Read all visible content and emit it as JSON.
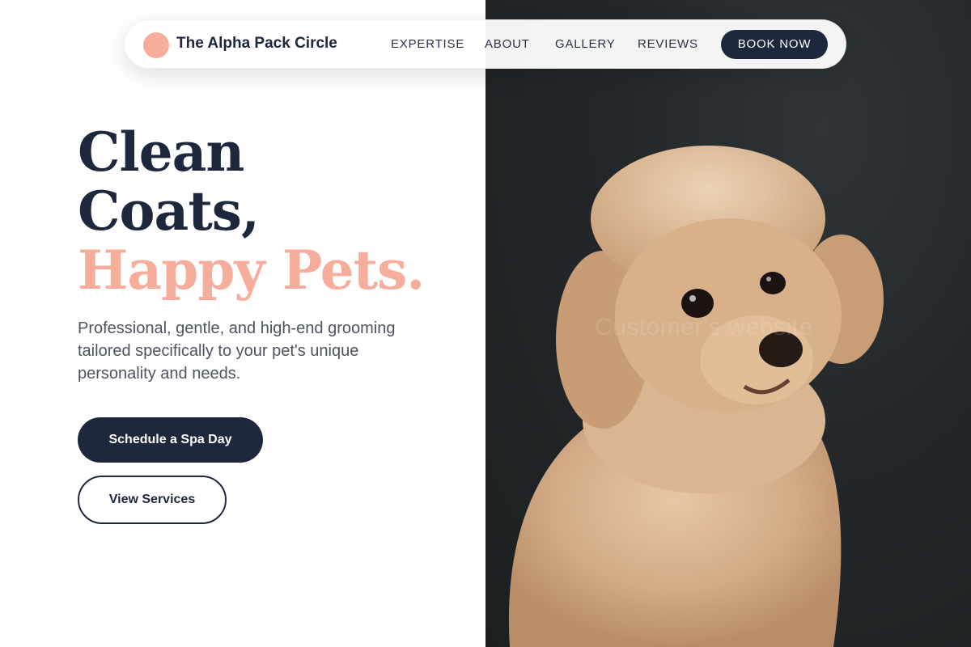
{
  "brand": {
    "name": "The Alpha Pack Circle",
    "accent_color": "#f6ad9b",
    "dark_color": "#1d283c"
  },
  "nav": {
    "links": [
      "EXPERTISE",
      "ABOUT",
      "GALLERY",
      "REVIEWS"
    ],
    "cta": "BOOK NOW"
  },
  "hero": {
    "headline_line1": "Clean",
    "headline_line2": "Coats,",
    "headline_accent": "Happy Pets.",
    "subtitle": "Professional, gentle, and high-end grooming tailored specifically to your pet's unique personality and needs.",
    "primary_button": "Schedule a Spa Day",
    "secondary_button": "View Services"
  },
  "photo": {
    "subject_icon": "poodle-photo",
    "watermark": "Customer's website"
  }
}
